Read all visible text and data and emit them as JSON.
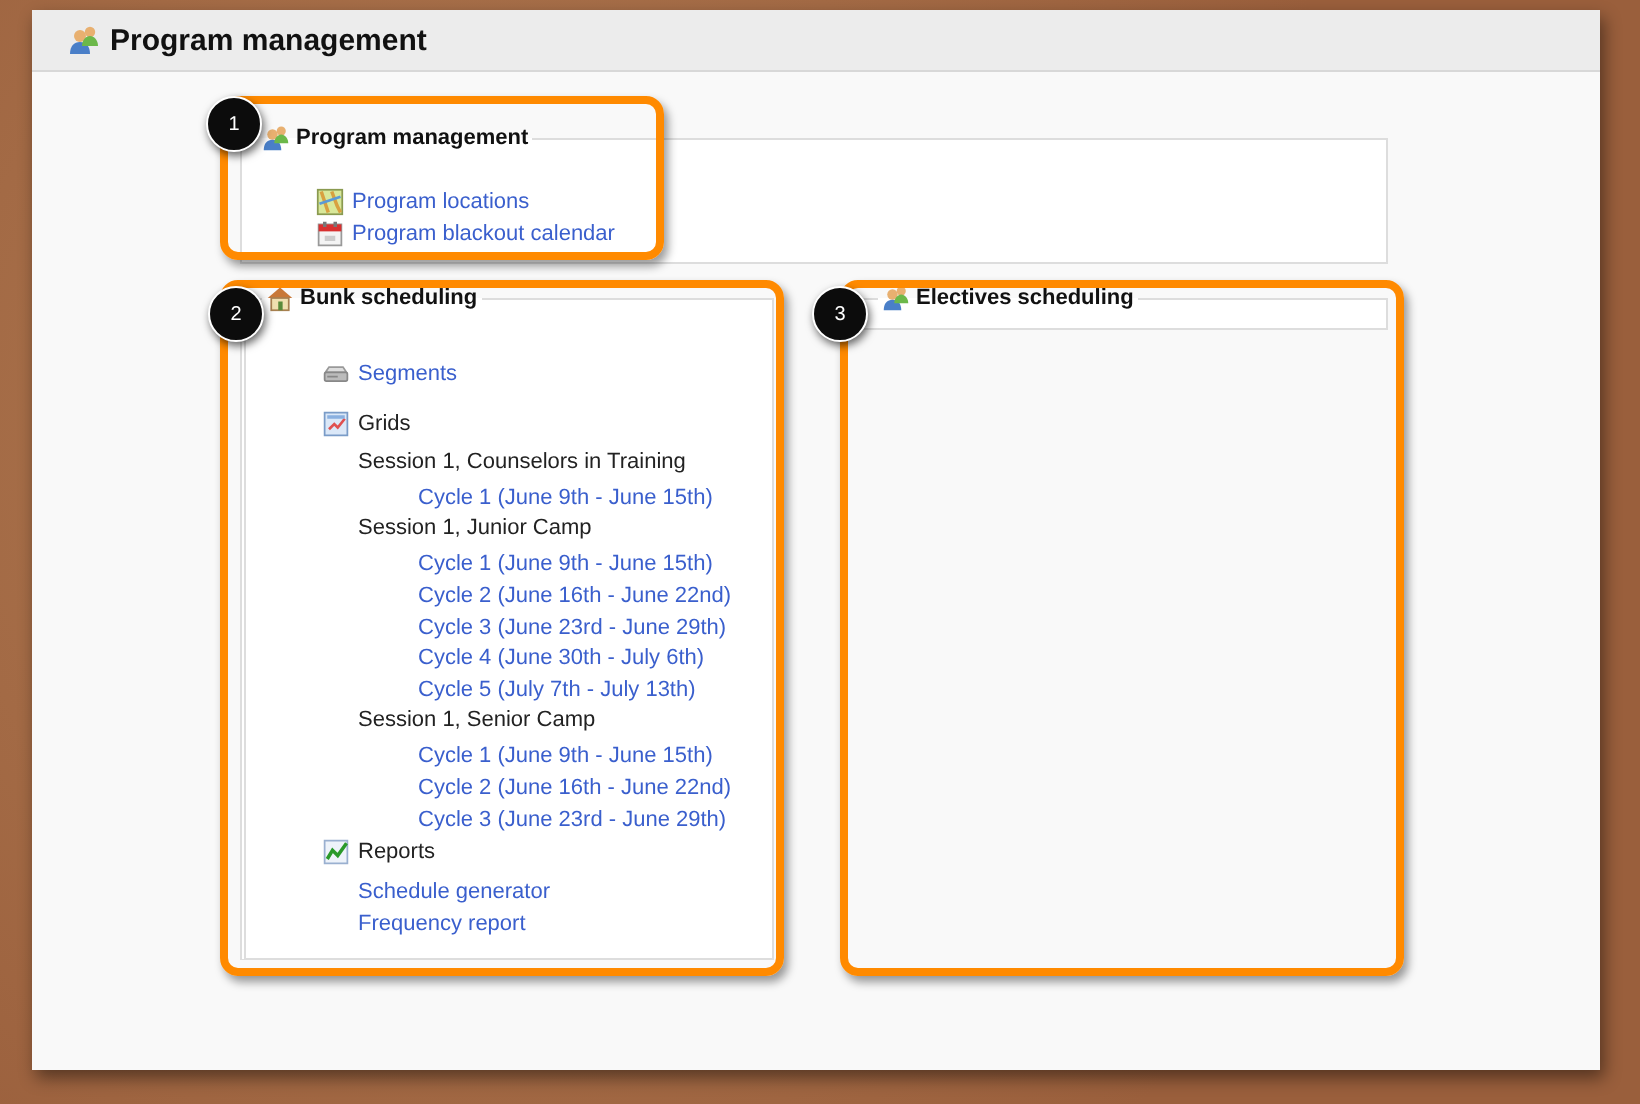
{
  "page": {
    "title": "Program management"
  },
  "sections": [
    {
      "title": "Program management",
      "items": [
        {
          "kind": "link",
          "label": "Program locations"
        },
        {
          "kind": "link",
          "label": "Program blackout calendar"
        }
      ]
    },
    {
      "title": "Bunk scheduling",
      "items": [
        {
          "kind": "link",
          "label": "Segments"
        },
        {
          "kind": "heading",
          "label": "Grids",
          "children": [
            {
              "kind": "group",
              "label": "Session 1, Counselors in Training",
              "children": [
                {
                  "kind": "link",
                  "label": "Cycle 1 (June 9th - June 15th)"
                }
              ]
            },
            {
              "kind": "group",
              "label": "Session 1, Junior Camp",
              "children": [
                {
                  "kind": "link",
                  "label": "Cycle 1 (June 9th - June 15th)"
                },
                {
                  "kind": "link",
                  "label": "Cycle 2 (June 16th - June 22nd)"
                },
                {
                  "kind": "link",
                  "label": "Cycle 3 (June 23rd - June 29th)"
                },
                {
                  "kind": "link",
                  "label": "Cycle 4 (June 30th - July 6th)"
                },
                {
                  "kind": "link",
                  "label": "Cycle 5 (July 7th - July 13th)"
                }
              ]
            },
            {
              "kind": "group",
              "label": "Session 1, Senior Camp",
              "children": [
                {
                  "kind": "link",
                  "label": "Cycle 1 (June 9th - June 15th)"
                },
                {
                  "kind": "link",
                  "label": "Cycle 2 (June 16th - June 22nd)"
                },
                {
                  "kind": "link",
                  "label": "Cycle 3 (June 23rd - June 29th)"
                }
              ]
            }
          ]
        },
        {
          "kind": "heading",
          "label": "Reports",
          "children": [
            {
              "kind": "link",
              "label": "Schedule generator"
            },
            {
              "kind": "link",
              "label": "Frequency report"
            }
          ]
        }
      ]
    },
    {
      "title": "Electives scheduling"
    }
  ],
  "annotations": [
    {
      "label": "1"
    },
    {
      "label": "2"
    },
    {
      "label": "3"
    }
  ]
}
